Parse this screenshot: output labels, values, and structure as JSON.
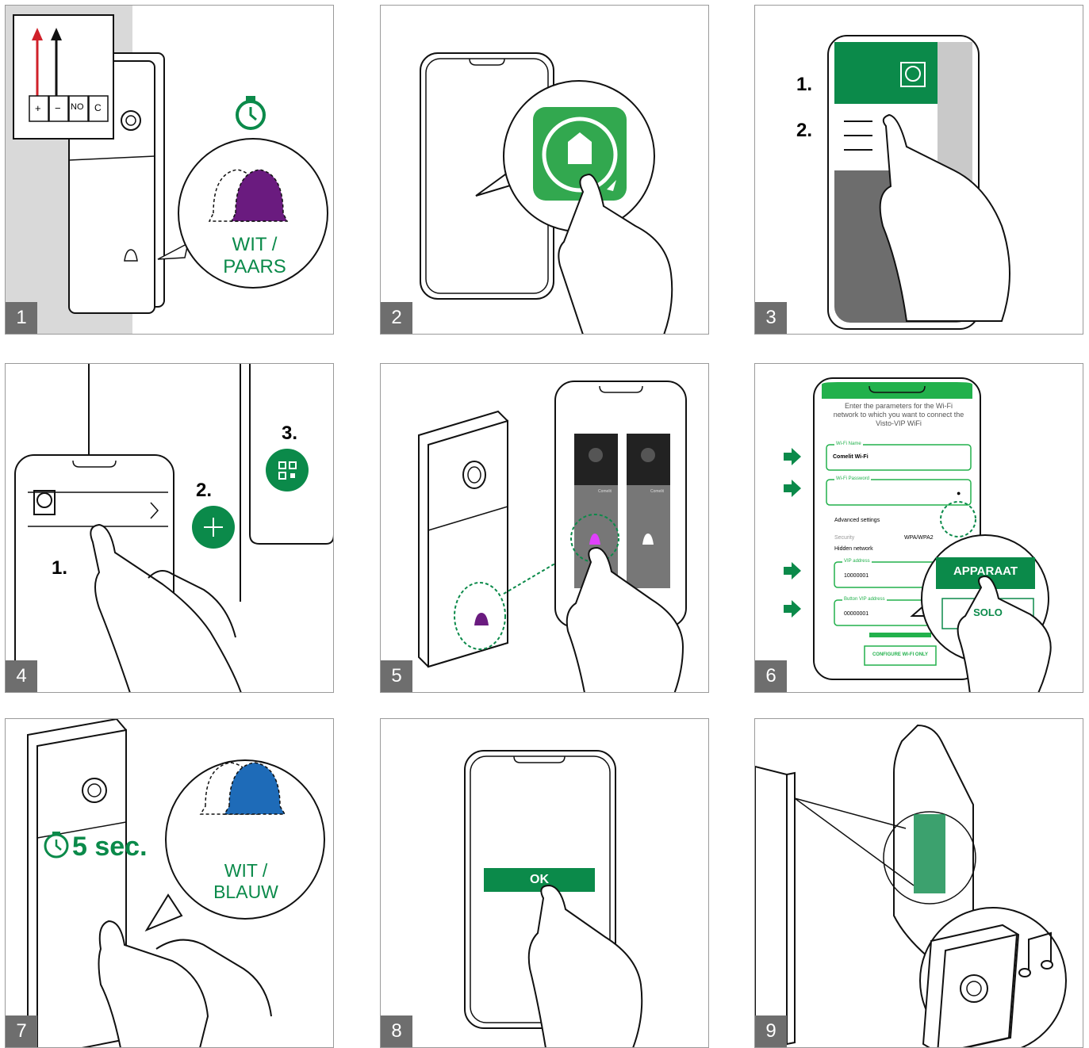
{
  "colors": {
    "green": "#0b8a4a",
    "purple": "#6a1b7f",
    "blue": "#1e6bb8",
    "red": "#d0212a",
    "panel_number_bg": "#6e6e6e"
  },
  "steps": [
    {
      "number": "1",
      "terminals": [
        "+",
        "−",
        "NO",
        "C"
      ],
      "bubble_text": "WIT / PAARS",
      "icons": [
        "timer-icon",
        "bell-icon"
      ]
    },
    {
      "number": "2",
      "icons": [
        "app-icon"
      ]
    },
    {
      "number": "3",
      "markers": [
        "1.",
        "2."
      ],
      "icons": [
        "camera-icon",
        "menu-icon"
      ]
    },
    {
      "number": "4",
      "markers": [
        "1.",
        "2.",
        "3."
      ],
      "icons": [
        "camera-icon",
        "chevron-right-icon",
        "plus-icon",
        "qr-icon"
      ]
    },
    {
      "number": "5",
      "phone_brand": "Comelit",
      "icons": [
        "bell-icon"
      ]
    },
    {
      "number": "6",
      "intro_text": "Enter the parameters for the Wi-Fi network to which you want to connect the Visto-VIP WiFi",
      "wifi_name_label": "Wi-Fi Name",
      "wifi_name_value": "Comelit Wi-Fi",
      "wifi_password_label": "Wi-Fi Password",
      "advanced_label": "Advanced settings",
      "security_label": "Security",
      "security_value": "WPA/WPA2",
      "hidden_network_label": "Hidden network",
      "vip_address_label": "VIP address",
      "vip_address_value": "10000001",
      "button_vip_label": "Button VIP address",
      "button_vip_value": "00000001",
      "configure_button": "CONFIGURE WI-FI ONLY",
      "apparaat_button": "APPARAAT",
      "solo_button": "SOLO"
    },
    {
      "number": "7",
      "timer_text": "5 sec.",
      "bubble_text": "WIT / BLAUW"
    },
    {
      "number": "8",
      "ok_button": "OK"
    },
    {
      "number": "9",
      "icons": [
        "music-note-icon",
        "qr-code"
      ]
    }
  ]
}
